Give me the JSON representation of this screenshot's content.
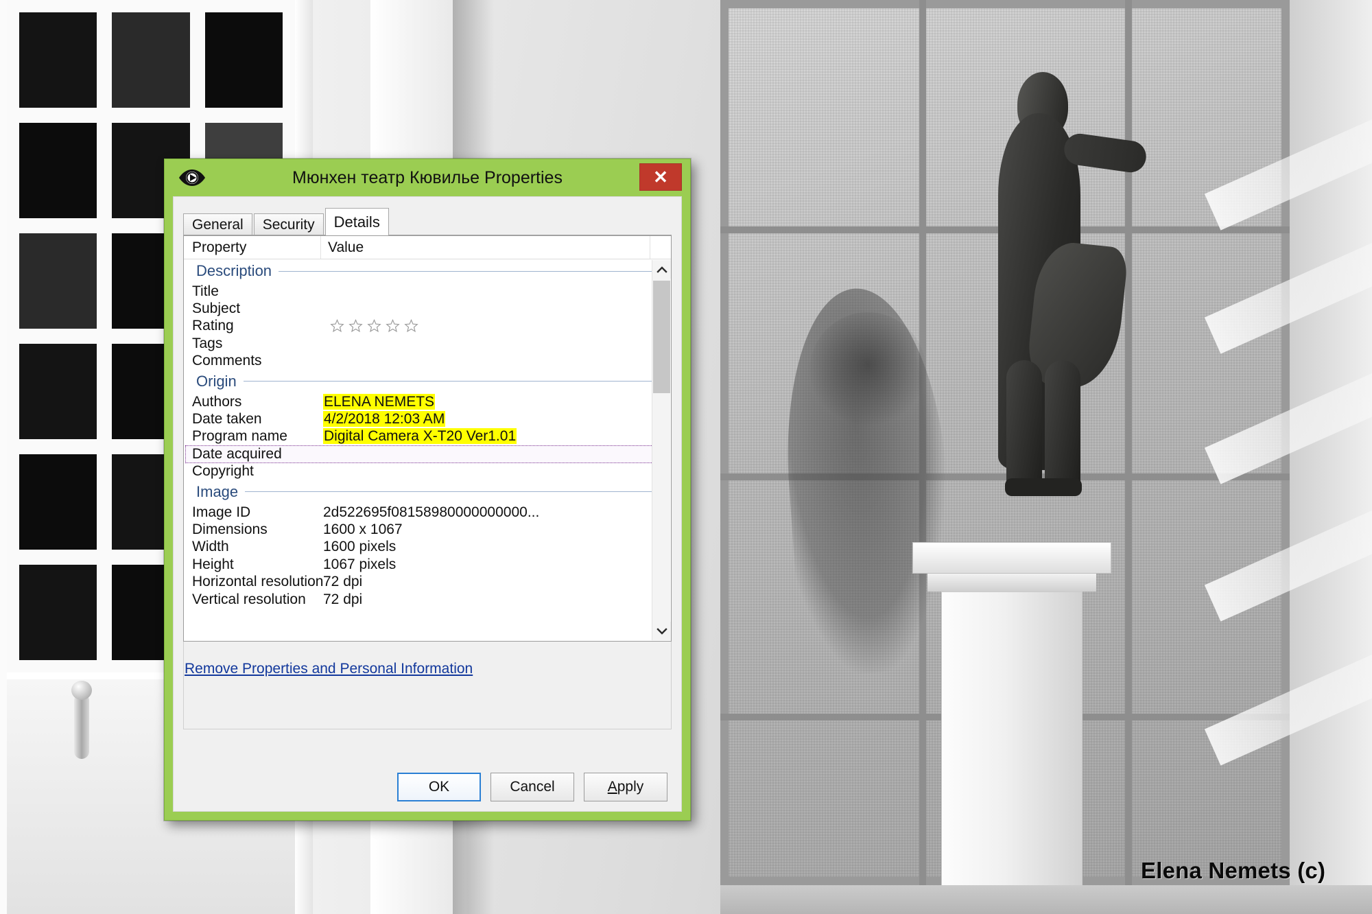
{
  "window": {
    "title": "Мюнхен театр Кювилье Properties",
    "icon": "media-viewer-eye-icon",
    "close_label": "✕",
    "chrome_color": "#9bcd52",
    "close_color": "#c0392b"
  },
  "tabs": [
    {
      "label": "General",
      "active": false
    },
    {
      "label": "Security",
      "active": false
    },
    {
      "label": "Details",
      "active": true
    }
  ],
  "list": {
    "columns": {
      "property": "Property",
      "value": "Value"
    },
    "groups": [
      {
        "name": "Description",
        "rows": [
          {
            "key": "Title",
            "value": ""
          },
          {
            "key": "Subject",
            "value": ""
          },
          {
            "key": "Rating",
            "value": "",
            "stars": 5,
            "filled": 0
          },
          {
            "key": "Tags",
            "value": ""
          },
          {
            "key": "Comments",
            "value": ""
          }
        ]
      },
      {
        "name": "Origin",
        "rows": [
          {
            "key": "Authors",
            "value": "ELENA NEMETS",
            "highlight": true
          },
          {
            "key": "Date taken",
            "value": "4/2/2018 12:03 AM",
            "highlight": true
          },
          {
            "key": "Program name",
            "value": "Digital Camera X-T20 Ver1.01",
            "highlight": true
          },
          {
            "key": "Date acquired",
            "value": "",
            "selected": true
          },
          {
            "key": "Copyright",
            "value": ""
          }
        ]
      },
      {
        "name": "Image",
        "rows": [
          {
            "key": "Image ID",
            "value": "2d522695f08158980000000000..."
          },
          {
            "key": "Dimensions",
            "value": "1600 x 1067"
          },
          {
            "key": "Width",
            "value": "1600 pixels"
          },
          {
            "key": "Height",
            "value": "1067 pixels"
          },
          {
            "key": "Horizontal resolution",
            "value": "72 dpi"
          },
          {
            "key": "Vertical resolution",
            "value": "72 dpi"
          }
        ]
      }
    ]
  },
  "remove_link": "Remove Properties and Personal Information",
  "buttons": [
    {
      "label": "OK",
      "default": true,
      "accel": ""
    },
    {
      "label": "Cancel",
      "default": false,
      "accel": ""
    },
    {
      "label": "Apply",
      "default": false,
      "accel": "A"
    }
  ],
  "scrollbar": {
    "up_icon": "chevron-up-icon",
    "down_icon": "chevron-down-icon"
  },
  "watermark": "Elena Nemets (c)"
}
